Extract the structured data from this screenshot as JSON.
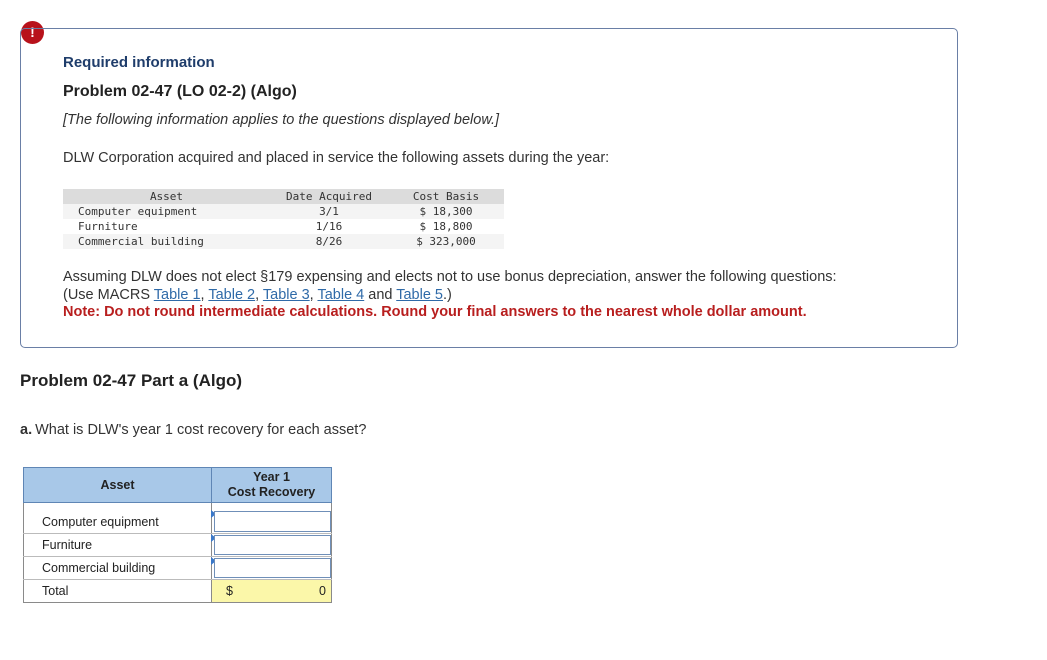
{
  "alert_icon": "!",
  "info": {
    "required_title": "Required information",
    "problem_title": "Problem 02-47 (LO 02-2) (Algo)",
    "italic_note": "[The following information applies to the questions displayed below.]",
    "intro": "DLW Corporation acquired and placed in service the following assets during the year:",
    "asset_table": {
      "headers": [
        "Asset",
        "Date Acquired",
        "Cost Basis"
      ],
      "rows": [
        [
          "Computer equipment",
          "3/1",
          "$ 18,300"
        ],
        [
          "Furniture",
          "1/16",
          "$ 18,800"
        ],
        [
          "Commercial building",
          "8/26",
          "$ 323,000"
        ]
      ]
    },
    "assume_text": "Assuming DLW does not elect §179 expensing and elects not to use bonus depreciation, answer the following questions:",
    "use_prefix": "(Use MACRS ",
    "links": [
      "Table 1",
      "Table 2",
      "Table 3",
      "Table 4",
      "Table 5"
    ],
    "sep_comma": ", ",
    "sep_and": " and ",
    "use_suffix": ".)",
    "note_label": "Note:",
    "note_text": "Do not round intermediate calculations. Round your final answers to the nearest whole dollar amount."
  },
  "part": {
    "title": "Problem 02-47 Part a (Algo)",
    "question_letter": "a.",
    "question_text": "What is DLW's year 1 cost recovery for each asset?"
  },
  "answer_table": {
    "header_asset": "Asset",
    "header_recovery_line1": "Year 1",
    "header_recovery_line2": "Cost Recovery",
    "rows": [
      {
        "label": "Computer equipment",
        "value": ""
      },
      {
        "label": "Furniture",
        "value": ""
      },
      {
        "label": "Commercial building",
        "value": ""
      }
    ],
    "total_label": "Total",
    "total_currency": "$",
    "total_value": "0"
  },
  "colors": {
    "alert": "#b8121b",
    "note": "#b81e1e",
    "link": "#2f6aa8",
    "header_fill": "#a8c8e8",
    "total_fill": "#fbf7a9"
  }
}
